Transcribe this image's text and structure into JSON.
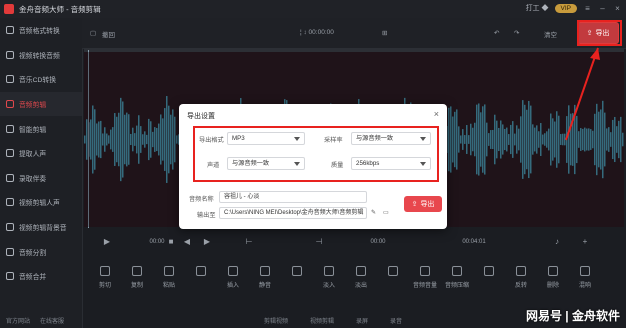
{
  "app": {
    "title": "金舟音频大师 - 音频剪辑",
    "vip_label": "打工 ◆",
    "vip_badge": "VIP"
  },
  "toolbar": {
    "undo_label": "撤回",
    "time": "¦ ↕ 00:00:00",
    "clear_label": "清空",
    "export_label": "导出"
  },
  "sidebar": {
    "items": [
      {
        "label": "音频格式转换",
        "active": false
      },
      {
        "label": "视频转换音频",
        "active": false
      },
      {
        "label": "音乐CD转换",
        "active": false
      },
      {
        "label": "音频剪辑",
        "active": true
      },
      {
        "label": "智能剪辑",
        "active": false
      },
      {
        "label": "提取人声",
        "active": false
      },
      {
        "label": "录取伴奏",
        "active": false
      },
      {
        "label": "视频剪辑人声",
        "active": false
      },
      {
        "label": "视频剪辑背景音",
        "active": false
      },
      {
        "label": "音频分割",
        "active": false
      },
      {
        "label": "音频合并",
        "active": false
      }
    ],
    "footer": [
      "官方网站",
      "在线客服"
    ]
  },
  "dialog": {
    "title": "导出设置",
    "format_label": "导出格式",
    "format_value": "MP3",
    "samplerate_label": "采样率",
    "samplerate_value": "与源音频一致",
    "channel_label": "声道",
    "channel_value": "与源音频一致",
    "quality_label": "质量",
    "quality_value": "256kbps",
    "name_label": "音频名称",
    "name_value": "容祖儿 - 心淡",
    "output_label": "输出至",
    "output_path": "C:\\Users\\NING MEI\\Desktop\\金舟音频大师\\音频剪辑",
    "export_button": "导出"
  },
  "controls": {
    "time_left": "00:00",
    "time_mid": "00:00",
    "time_right": "00:04:01"
  },
  "tools": [
    "剪切",
    "复制",
    "粘贴",
    "",
    "插入",
    "静音",
    "",
    "淡入",
    "淡出",
    "",
    "音频音量",
    "音频压缩",
    "",
    "反转",
    "删除",
    "混响"
  ],
  "bottom": [
    "剪辑视频",
    "视频剪辑",
    "录屏",
    "录音"
  ],
  "watermark": "网易号 | 金舟软件",
  "colors": {
    "accent": "#e8474d",
    "highlight": "#e8221f",
    "wave": "#4ea0b8"
  }
}
